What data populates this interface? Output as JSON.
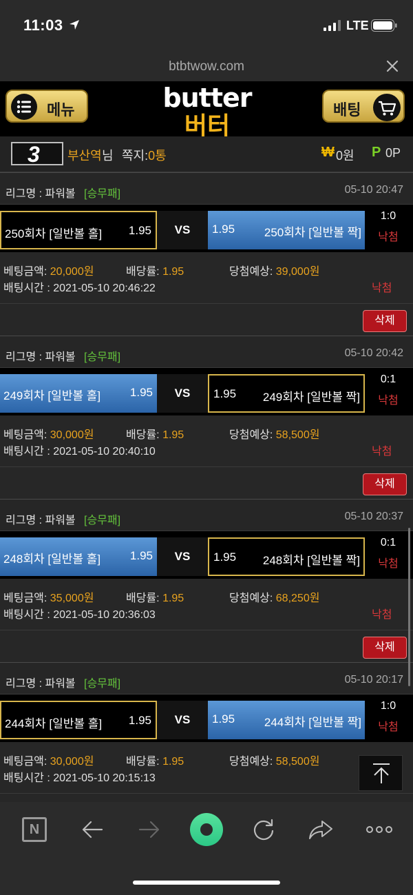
{
  "status": {
    "time": "11:03",
    "network": "LTE"
  },
  "browser": {
    "url": "btbtwow.com"
  },
  "header": {
    "menu_label": "메뉴",
    "bet_label": "배팅",
    "logo_top": "butter",
    "logo_bottom": "버터"
  },
  "user": {
    "level": "3",
    "name": "부산역",
    "name_suffix": "님",
    "messages_label": "쪽지:",
    "messages_count": "0통",
    "won_symbol": "₩",
    "balance": "0원",
    "points_symbol": "P",
    "points": "0P"
  },
  "bets": [
    {
      "league_label": "리그명 : 파워볼",
      "league_type": "[승무패]",
      "date": "05-10 20:47",
      "home_name": "250회차 [일반볼 홀]",
      "home_odds": "1.95",
      "vs": "VS",
      "away_odds": "1.95",
      "away_name": "250회차 [일반볼 짝]",
      "score": "1:0",
      "result": "낙첨",
      "amount_label": "베팅금액:",
      "amount": "20,000원",
      "odds_label": "배당률:",
      "odds": "1.95",
      "expected_label": "당첨예상:",
      "expected": "39,000원",
      "time_label": "배팅시간 :",
      "time": "2021-05-10 20:46:22",
      "result_bottom": "낙첨",
      "delete_label": "삭제",
      "selected": "home"
    },
    {
      "league_label": "리그명 : 파워볼",
      "league_type": "[승무패]",
      "date": "05-10 20:42",
      "home_name": "249회차 [일반볼 홀]",
      "home_odds": "1.95",
      "vs": "VS",
      "away_odds": "1.95",
      "away_name": "249회차 [일반볼 짝]",
      "score": "0:1",
      "result": "낙첨",
      "amount_label": "베팅금액:",
      "amount": "30,000원",
      "odds_label": "배당률:",
      "odds": "1.95",
      "expected_label": "당첨예상:",
      "expected": "58,500원",
      "time_label": "배팅시간 :",
      "time": "2021-05-10 20:40:10",
      "result_bottom": "낙첨",
      "delete_label": "삭제",
      "selected": "away"
    },
    {
      "league_label": "리그명 : 파워볼",
      "league_type": "[승무패]",
      "date": "05-10 20:37",
      "home_name": "248회차 [일반볼 홀]",
      "home_odds": "1.95",
      "vs": "VS",
      "away_odds": "1.95",
      "away_name": "248회차 [일반볼 짝]",
      "score": "0:1",
      "result": "낙첨",
      "amount_label": "베팅금액:",
      "amount": "35,000원",
      "odds_label": "배당률:",
      "odds": "1.95",
      "expected_label": "당첨예상:",
      "expected": "68,250원",
      "time_label": "배팅시간 :",
      "time": "2021-05-10 20:36:03",
      "result_bottom": "낙첨",
      "delete_label": "삭제",
      "selected": "away"
    },
    {
      "league_label": "리그명 : 파워볼",
      "league_type": "[승무패]",
      "date": "05-10 20:17",
      "home_name": "244회차 [일반볼 홀]",
      "home_odds": "1.95",
      "vs": "VS",
      "away_odds": "1.95",
      "away_name": "244회차 [일반볼 짝]",
      "score": "1:0",
      "result": "낙첨",
      "amount_label": "베팅금액:",
      "amount": "30,000원",
      "odds_label": "배당률:",
      "odds": "1.95",
      "expected_label": "당첨예상:",
      "expected": "58,500원",
      "time_label": "배팅시간 :",
      "time": "2021-05-10 20:15:13",
      "result_bottom": "",
      "delete_label": "",
      "selected": "home"
    }
  ],
  "toolbar": {
    "n_label": "N"
  },
  "colors": {
    "accent_gold": "#d8b64c",
    "pick_blue": "#3a78c0",
    "loss_red": "#d8383a",
    "league_green": "#64c33c",
    "delete_red": "#b3151d"
  }
}
